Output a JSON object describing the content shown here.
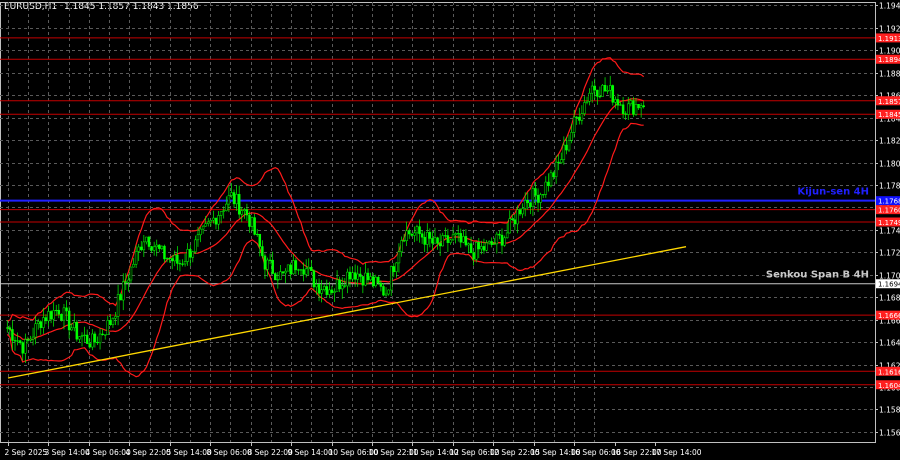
{
  "title": {
    "symbol": "EURUSD,H1",
    "ohlc": "1.1845 1.1857 1.1843 1.1856"
  },
  "chart_data": {
    "type": "candlestick",
    "symbol": "EURUSD,H1",
    "y_ticks": [
      "1.1942",
      "1.1922",
      "1.1902",
      "1.1882",
      "1.1862",
      "1.1842",
      "1.1822",
      "1.1802",
      "1.1782",
      "1.1762",
      "1.1742",
      "1.1722",
      "1.1702",
      "1.1682",
      "1.1662",
      "1.1642",
      "1.1622",
      "1.1602",
      "1.1582",
      "1.1562"
    ],
    "ylim": [
      1.1553,
      1.1945
    ],
    "x_ticks": [
      "2 Sep 2025",
      "3 Sep 14:00",
      "4 Sep 06:00",
      "4 Sep 22:00",
      "5 Sep 14:00",
      "8 Sep 06:00",
      "8 Sep 22:00",
      "9 Sep 14:00",
      "10 Sep 06:00",
      "10 Sep 22:00",
      "11 Sep 14:00",
      "12 Sep 06:00",
      "12 Sep 22:00",
      "15 Sep 14:00",
      "16 Sep 06:00",
      "16 Sep 22:00",
      "17 Sep 14:00"
    ],
    "price_marker_labels": [
      {
        "value": 1.1913,
        "text": "1.1913",
        "color": "#ff2020"
      },
      {
        "value": 1.1894,
        "text": "1.1894",
        "color": "#ff2020"
      },
      {
        "value": 1.1857,
        "text": "1.1857",
        "color": "#ff2020"
      },
      {
        "value": 1.1845,
        "text": "1.1845",
        "color": "#ff2020"
      },
      {
        "value": 1.1768,
        "text": "1.1768",
        "color": "#1010ff"
      },
      {
        "value": 1.176,
        "text": "1.1760",
        "color": "#ff2020"
      },
      {
        "value": 1.1749,
        "text": "1.1749",
        "color": "#ff2020"
      },
      {
        "value": 1.1694,
        "text": "1.1694",
        "color": "#ffffff"
      },
      {
        "value": 1.1666,
        "text": "1.1666",
        "color": "#ff2020"
      },
      {
        "value": 1.1616,
        "text": "1.1616",
        "color": "#ff2020"
      },
      {
        "value": 1.1604,
        "text": "1.1604",
        "color": "#ff2020"
      }
    ],
    "levels": [
      {
        "value": 1.1913,
        "color": "#c40000"
      },
      {
        "value": 1.1894,
        "color": "#c40000"
      },
      {
        "value": 1.1857,
        "color": "#c40000"
      },
      {
        "value": 1.1845,
        "color": "#c40000"
      },
      {
        "value": 1.1768,
        "color": "#2020ff",
        "label": "Kijun-sen 4H"
      },
      {
        "value": 1.176,
        "color": "#c40000"
      },
      {
        "value": 1.1749,
        "color": "#c40000"
      },
      {
        "value": 1.1694,
        "color": "#c8c8c8",
        "label": "Senkou Span B 4H"
      },
      {
        "value": 1.1666,
        "color": "#c40000"
      },
      {
        "value": 1.1616,
        "color": "#c40000"
      },
      {
        "value": 1.1604,
        "color": "#c40000"
      }
    ],
    "trendline": {
      "color": "#ffd700",
      "from": {
        "x": "2 Sep 2025",
        "y": 1.161
      },
      "to": {
        "x": "17 Sep 14:00",
        "y": 1.1727
      }
    },
    "price_anchors": [
      1.1655,
      1.1637,
      1.1663,
      1.1672,
      1.165,
      1.1641,
      1.166,
      1.17,
      1.1738,
      1.172,
      1.1712,
      1.173,
      1.1752,
      1.1772,
      1.1755,
      1.1712,
      1.17,
      1.1715,
      1.1693,
      1.169,
      1.1706,
      1.1698,
      1.1686,
      1.174,
      1.1738,
      1.1727,
      1.1735,
      1.1722,
      1.1727,
      1.1738,
      1.1767,
      1.1775,
      1.1798,
      1.1838,
      1.187,
      1.1865,
      1.185,
      1.1856
    ],
    "colors": {
      "up": "#00ff00",
      "down": "#00ff00",
      "bands": "#ff1a1a",
      "grid": "#5a5a5a",
      "axis_text": "#ffffff"
    }
  }
}
